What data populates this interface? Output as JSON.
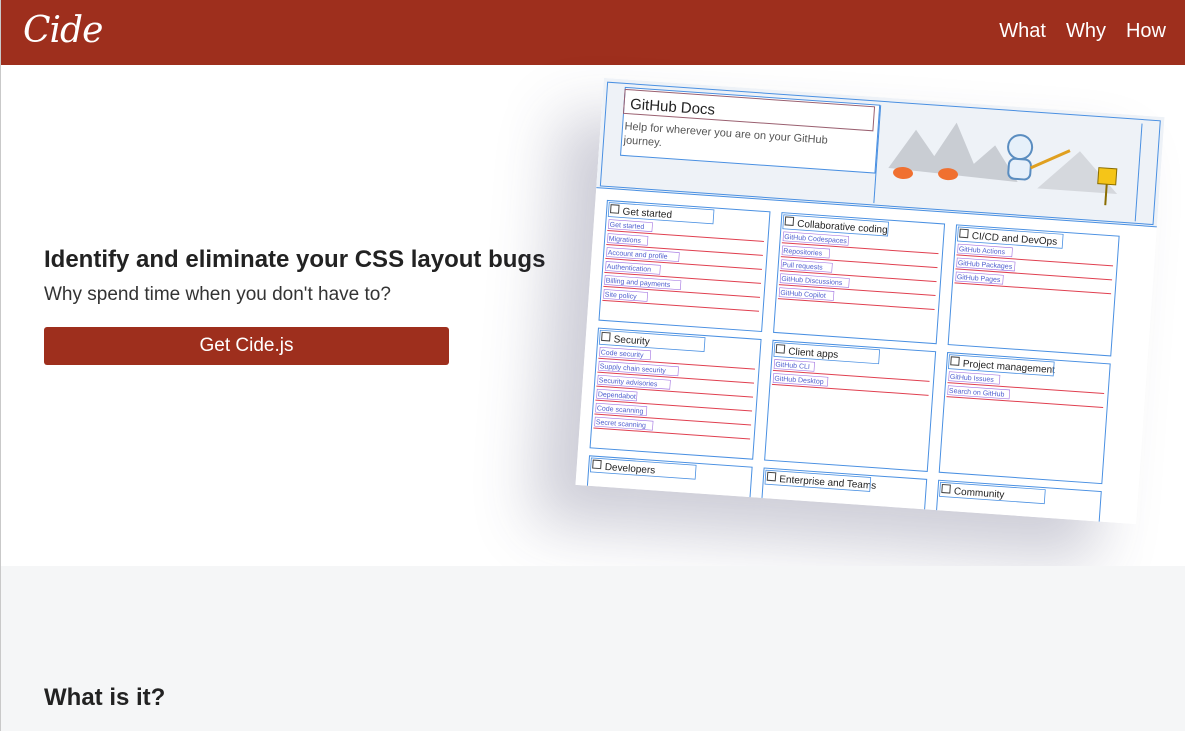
{
  "header": {
    "logo": "Cide",
    "nav": [
      {
        "label": "What"
      },
      {
        "label": "Why"
      },
      {
        "label": "How"
      }
    ]
  },
  "hero": {
    "title": "Identify and eliminate your CSS layout bugs",
    "subtitle": "Why spend time when you don't have to?",
    "cta_label": "Get Cide.js"
  },
  "preview": {
    "site_title": "GitHub Docs",
    "site_tagline_1": "Help for wherever you are on your GitHub",
    "site_tagline_2": "journey.",
    "sections": [
      {
        "title": "Get started",
        "links": [
          "Get started",
          "Migrations",
          "Account and profile",
          "Authentication",
          "Billing and payments",
          "Site policy"
        ]
      },
      {
        "title": "Collaborative coding",
        "links": [
          "GitHub Codespaces",
          "Repositories",
          "Pull requests",
          "GitHub Discussions",
          "GitHub Copilot"
        ]
      },
      {
        "title": "CI/CD and DevOps",
        "links": [
          "GitHub Actions",
          "GitHub Packages",
          "GitHub Pages"
        ]
      },
      {
        "title": "Security",
        "links": [
          "Code security",
          "Supply chain security",
          "Security advisories",
          "Dependabot",
          "Code scanning",
          "Secret scanning"
        ]
      },
      {
        "title": "Client apps",
        "links": [
          "GitHub CLI",
          "GitHub Desktop"
        ]
      },
      {
        "title": "Project management",
        "links": [
          "GitHub Issues",
          "Search on GitHub"
        ]
      },
      {
        "title": "Developers",
        "links": []
      },
      {
        "title": "Enterprise and Teams",
        "links": []
      },
      {
        "title": "Community",
        "links": []
      }
    ]
  },
  "lower": {
    "heading": "What is it?"
  },
  "colors": {
    "brand": "#9e2f1d",
    "outline_blue": "#4a90e2",
    "outline_red": "#e04050",
    "outline_purple": "#a070e0",
    "lower_bg": "#f5f6f7"
  }
}
